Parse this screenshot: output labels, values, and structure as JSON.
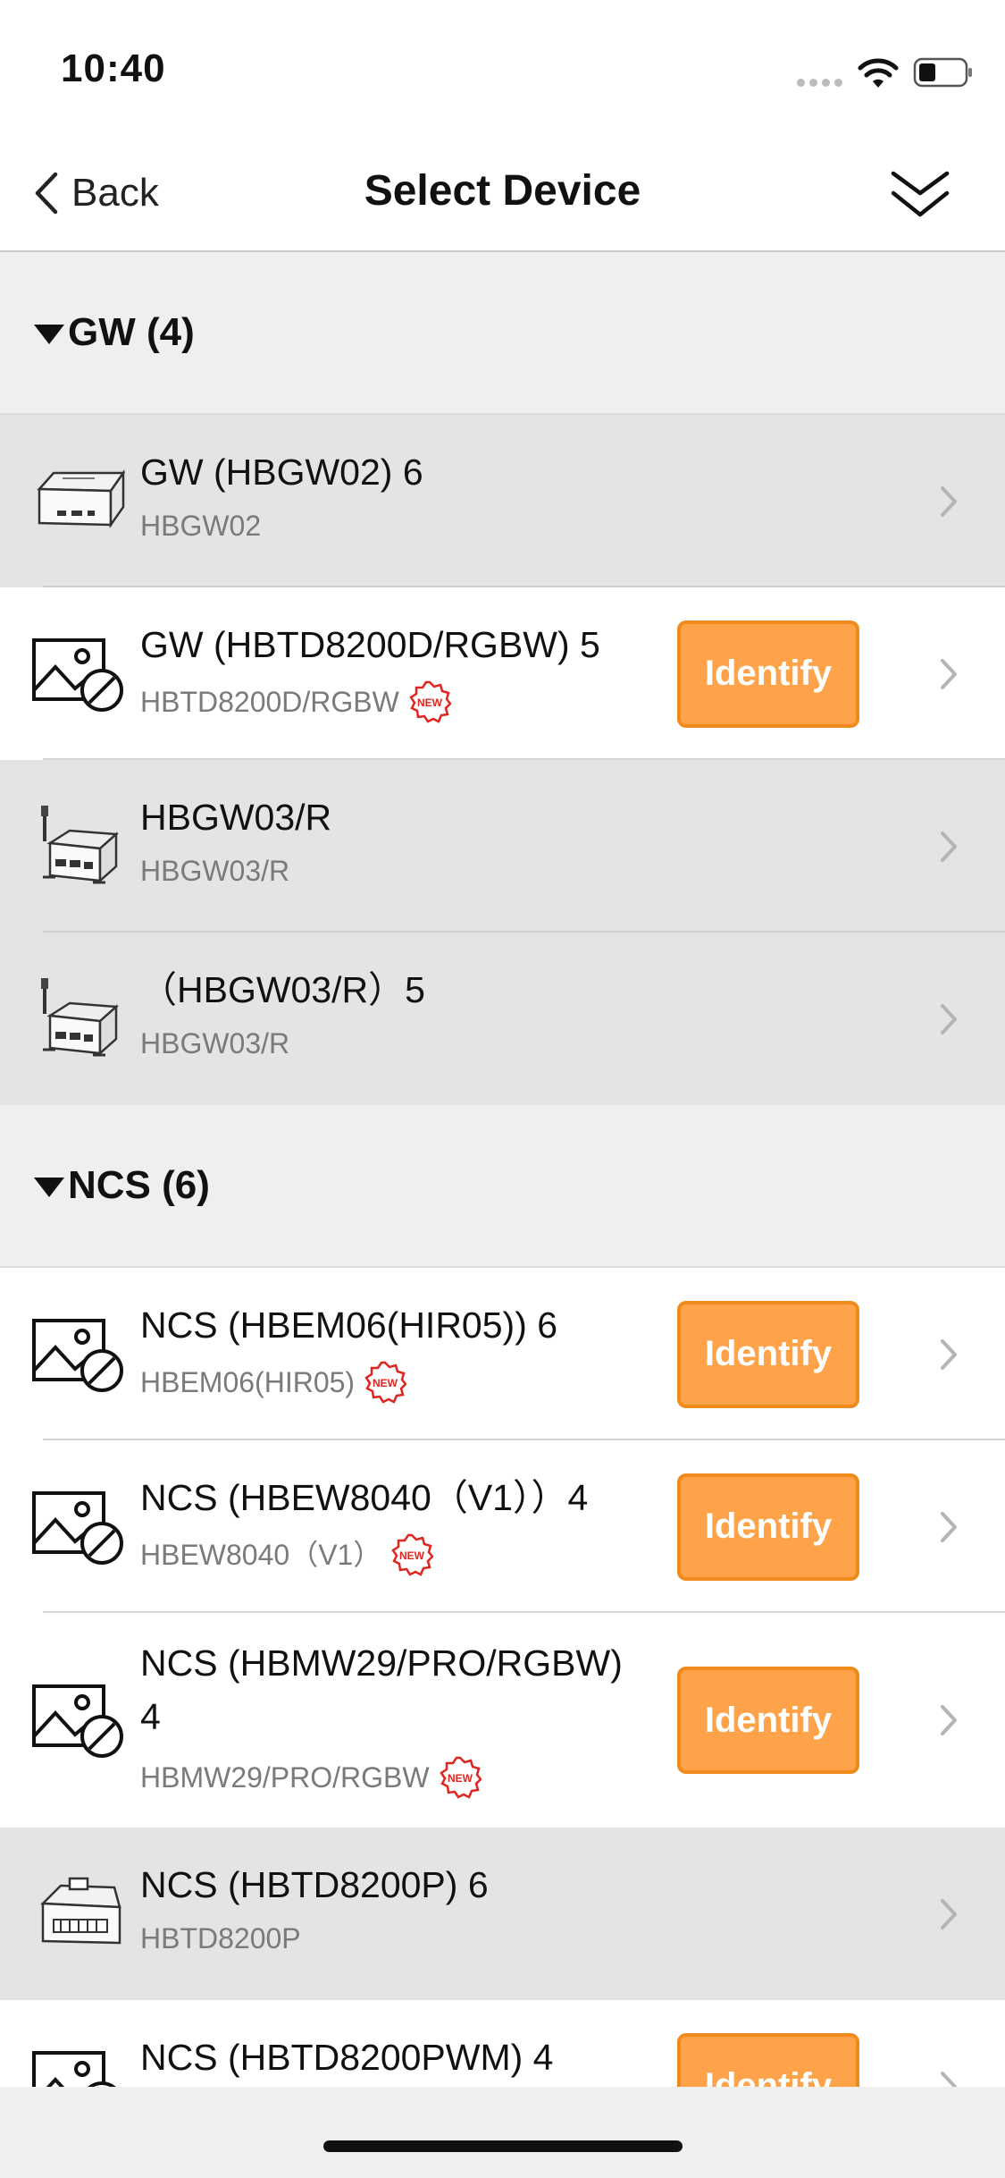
{
  "status_bar": {
    "time": "10:40"
  },
  "nav": {
    "back_label": "Back",
    "title": "Select Device"
  },
  "sections": [
    {
      "title": "GW (4)"
    },
    {
      "title": "NCS (6)"
    }
  ],
  "rows": [
    {
      "name": "GW (HBGW02) 6",
      "sub": "HBGW02"
    },
    {
      "name": "GW (HBTD8200D/RGBW) 5",
      "sub": "HBTD8200D/RGBW",
      "button": "Identify"
    },
    {
      "name": "HBGW03/R",
      "sub": "HBGW03/R"
    },
    {
      "name": "（HBGW03/R）5",
      "sub": "HBGW03/R"
    },
    {
      "name": "NCS (HBEM06(HIR05)) 6",
      "sub": "HBEM06(HIR05)",
      "button": "Identify"
    },
    {
      "name": "NCS (HBEW8040（V1））4",
      "sub": "HBEW8040（V1）",
      "button": "Identify"
    },
    {
      "name_line1": "NCS (HBMW29/PRO/RGBW)",
      "name_line2": "4",
      "sub": "HBMW29/PRO/RGBW",
      "button": "Identify"
    },
    {
      "name": "NCS (HBTD8200P) 6",
      "sub": "HBTD8200P"
    },
    {
      "name": "NCS (HBTD8200PWM) 4",
      "button": "Identify"
    }
  ],
  "badge_text": "NEW",
  "colors": {
    "identify_bg": "#ffa34a",
    "identify_border": "#f08a1c",
    "badge_red": "#e0251f"
  }
}
